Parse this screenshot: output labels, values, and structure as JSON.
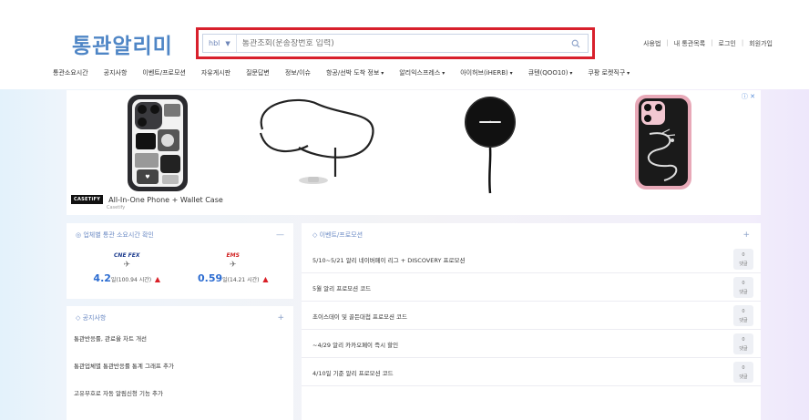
{
  "brand": {
    "logo_text": "통관알리미"
  },
  "search": {
    "type_select": "hbl",
    "placeholder": "통관조회(운송장번호 입력)"
  },
  "util_links": [
    "사용법",
    "내 통관목록",
    "로그인",
    "회원가입"
  ],
  "nav": [
    {
      "label": "통관소요시간",
      "dropdown": false
    },
    {
      "label": "공지사항",
      "dropdown": false
    },
    {
      "label": "이벤트/프로모션",
      "dropdown": false
    },
    {
      "label": "자유게시판",
      "dropdown": false
    },
    {
      "label": "질문답변",
      "dropdown": false
    },
    {
      "label": "정보/이슈",
      "dropdown": false
    },
    {
      "label": "항공/선박 도착 정보",
      "dropdown": true
    },
    {
      "label": "알리익스프레스",
      "dropdown": true
    },
    {
      "label": "아이허브(iHERB)",
      "dropdown": true
    },
    {
      "label": "큐텐(QOO10)",
      "dropdown": true
    },
    {
      "label": "쿠팡 로켓직구",
      "dropdown": true
    }
  ],
  "ad": {
    "brand": "CASETiFY",
    "title": "All-In-One Phone + Wallet Case",
    "subtitle": "Casetify",
    "close_label": "ⓘ ✕"
  },
  "clearance_time": {
    "title": "업체별 통관 소요시간 확인",
    "carriers": [
      {
        "name": "CNE FEX",
        "value": "4.2",
        "unit": "일",
        "detail": "(100.94 시간)"
      },
      {
        "name": "EMS",
        "value": "0.59",
        "unit": "일",
        "detail": "(14.21 시간)"
      }
    ]
  },
  "notice": {
    "title": "공지사항",
    "items": [
      "통관반응률, 관료율 차트 개선",
      "통관업체별 통관반응률 통계 그래프 추가",
      "고유부호로 자동 알림신청 기능 추가"
    ]
  },
  "events": {
    "title": "이벤트/프로모션",
    "items": [
      {
        "text": "5/10~5/21 알리 네이버페이 리그 + DISCOVERY 프로모션",
        "count": "0",
        "unit": "댓글"
      },
      {
        "text": "5월 알리 프로모션 코드",
        "count": "0",
        "unit": "댓글"
      },
      {
        "text": "초이스데이 및 골든대첩 프로모션 코드",
        "count": "0",
        "unit": "댓글"
      },
      {
        "text": "~4/29 알리 카카오페이 즉시 할인",
        "count": "0",
        "unit": "댓글"
      },
      {
        "text": "4/10일 기준 알리 프로모션 코드",
        "count": "0",
        "unit": "댓글"
      }
    ]
  },
  "colors": {
    "accent": "#4f86c6",
    "search_border": "#d8202c",
    "value_blue": "#2c6cd1",
    "up_red": "#d91f26"
  }
}
